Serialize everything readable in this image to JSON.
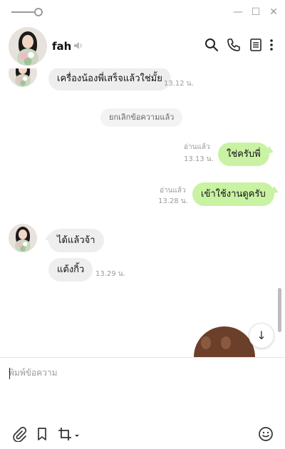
{
  "window": {
    "minimize_glyph": "—",
    "maximize_glyph": "☐",
    "close_glyph": "✕"
  },
  "header": {
    "contact_name": "fah",
    "icons": [
      "search-icon",
      "phone-icon",
      "notes-icon",
      "more-icon"
    ]
  },
  "chat": {
    "messages": [
      {
        "side": "in",
        "text": "เครื่องน้องพี่เสร็จแล้วใช่มั้ย",
        "time": "13.12 น."
      },
      {
        "side": "system",
        "text": "ยกเลิกข้อความแล้ว"
      },
      {
        "side": "out",
        "text": "ใช่ครับพี่",
        "read": "อ่านแล้ว",
        "time": "13.13 น."
      },
      {
        "side": "out",
        "text": "เข้าใช้งานดูครับ",
        "read": "อ่านแล้ว",
        "time": "13.28 น."
      },
      {
        "side": "in",
        "text": "ได้แล้วจ้า"
      },
      {
        "side": "in",
        "text": "แต้งกิ้ว",
        "time": "13.29 น."
      }
    ],
    "scroll_down_glyph": "↓"
  },
  "composer": {
    "placeholder": "พิมพ์ข้อความ",
    "value": "",
    "icons": [
      "attachment-icon",
      "bookmark-icon",
      "crop-icon",
      "emoji-icon"
    ]
  },
  "colors": {
    "outgoing_bubble": "#c9f2a3",
    "incoming_bubble": "#eeeeee",
    "meta_text": "#9a9a9a"
  }
}
